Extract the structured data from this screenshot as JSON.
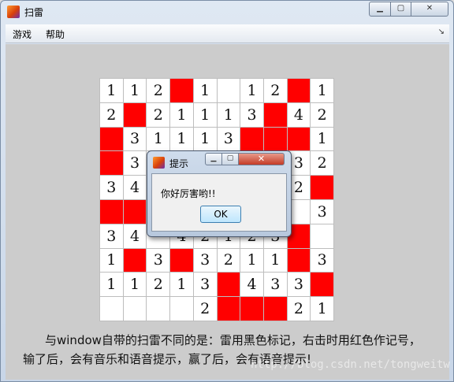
{
  "window": {
    "title": "扫雷"
  },
  "menu": {
    "items": [
      "游戏",
      "帮助"
    ],
    "corner": "↘"
  },
  "board": {
    "rows": [
      [
        "1",
        "1",
        "2",
        "F",
        "1",
        "",
        "1",
        "2",
        "F",
        "1"
      ],
      [
        "2",
        "F",
        "2",
        "1",
        "1",
        "1",
        "3",
        "F",
        "4",
        "2"
      ],
      [
        "F",
        "3",
        "1",
        "1",
        "1",
        "3",
        "F",
        "F",
        "F",
        "1"
      ],
      [
        "F",
        "3",
        "",
        "",
        "",
        "",
        "",
        "",
        "3",
        "2"
      ],
      [
        "3",
        "4",
        "",
        "",
        "",
        "",
        "",
        "",
        "2",
        "F"
      ],
      [
        "F",
        "F",
        "",
        "",
        "",
        "",
        "",
        "",
        "",
        "3"
      ],
      [
        "3",
        "4",
        "",
        "4",
        "2",
        "1",
        "2",
        "3",
        "F",
        ""
      ],
      [
        "1",
        "F",
        "3",
        "F",
        "3",
        "2",
        "1",
        "1",
        "F",
        "3"
      ],
      [
        "1",
        "1",
        "2",
        "1",
        "3",
        "F",
        "4",
        "3",
        "3",
        "F"
      ],
      [
        "",
        "",
        "",
        "",
        "2",
        "F",
        "F",
        "F",
        "2",
        "1"
      ]
    ],
    "flag_color": "#ff0000"
  },
  "dialog": {
    "title": "提示",
    "message": "你好厉害哟!!",
    "ok_label": "OK"
  },
  "message": {
    "line1": "与window自带的扫雷不同的是：雷用黑色标记，右击时用红色作记号，",
    "line2": "输了后，会有音乐和语音提示，赢了后，会有语音提示!"
  },
  "watermark": "http://blog.csdn.net/tongweitw"
}
